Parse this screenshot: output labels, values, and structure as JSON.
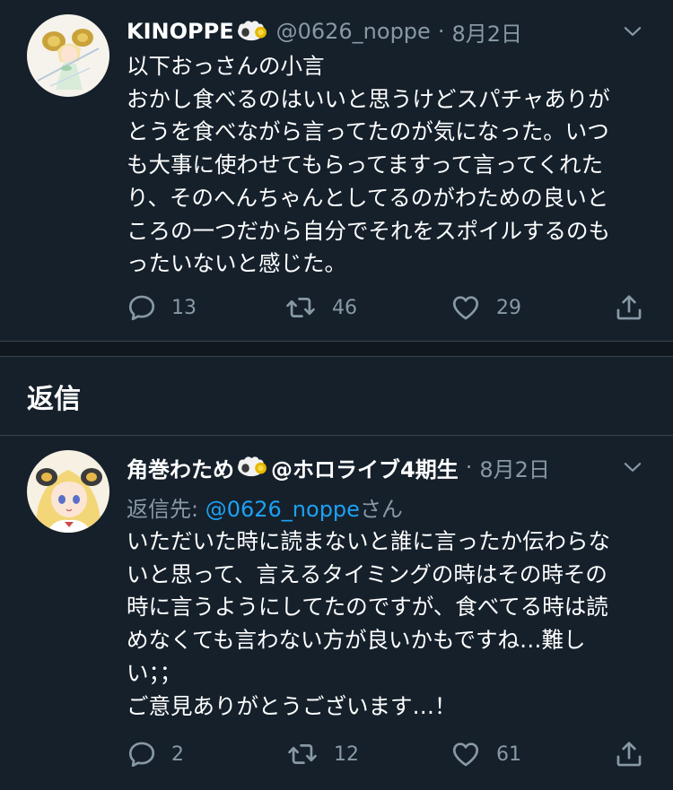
{
  "tweets": [
    {
      "name": "KINOPPE",
      "handle": "@0626_noppe",
      "separator": "·",
      "date": "8月2日",
      "avatar_icon": "anime-girl-with-horns-avatar",
      "body_lines": [
        "以下おっさんの小言",
        "おかし食べるのはいいと思うけどスパチャありが",
        "とうを食べながら言ってたのが気になった。いつ",
        "も大事に使わせてもらってますって言ってくれた",
        "り、そのへんちゃんとしてるのがわための良いと",
        "ころの一つだから自分でそれをスポイルするのも",
        "ったいないと感じた。"
      ],
      "replies": "13",
      "retweets": "46",
      "likes": "29"
    },
    {
      "name": "角巻わため",
      "name_suffix": "@ホロライブ4期生",
      "separator": "·",
      "date": "8月2日",
      "avatar_icon": "blonde-sheep-girl-avatar",
      "reply_to_label": "返信先: ",
      "reply_to_mention": "@0626_noppe",
      "reply_to_suffix": "さん",
      "body_lines": [
        "いただいた時に読まないと誰に言ったか伝わらな",
        "いと思って、言えるタイミングの時はその時その",
        "時に言うようにしてたのですが、食べてる時は読",
        "めなくても言わない方が良いかもですね…難し",
        "い；；",
        "ご意見ありがとうございます…！"
      ],
      "replies": "2",
      "retweets": "12",
      "likes": "61"
    }
  ],
  "section": {
    "title": "返信"
  },
  "colors": {
    "background": "#15202b",
    "separator": "#10171e",
    "text": "#ffffff",
    "muted": "#8899a6",
    "accent": "#1da1f2"
  }
}
